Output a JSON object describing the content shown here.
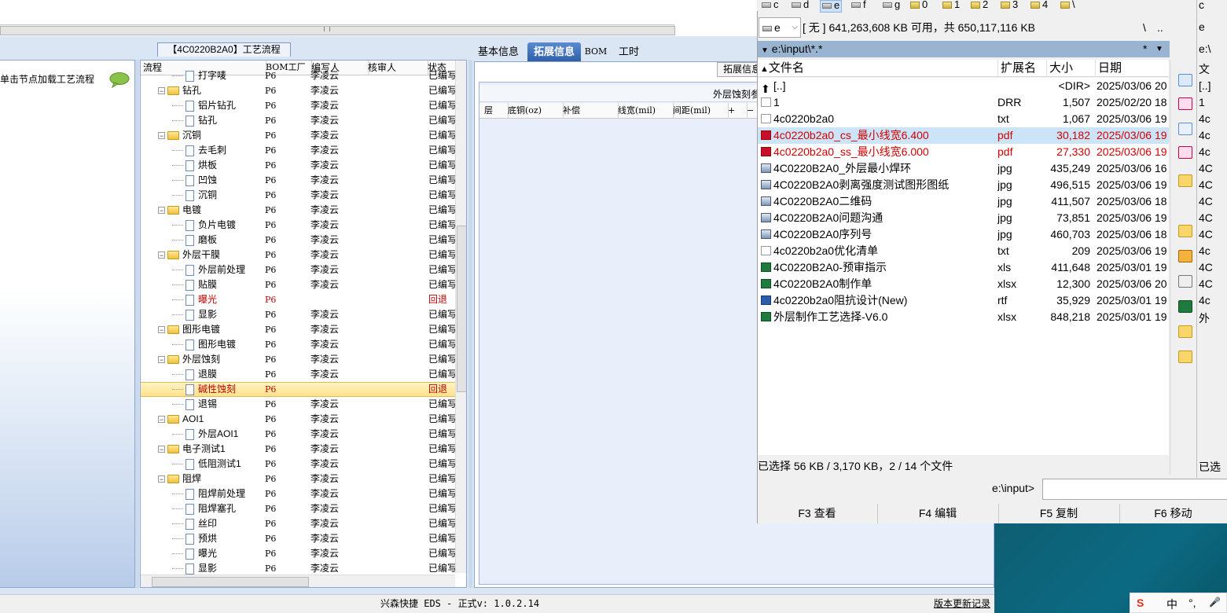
{
  "eds": {
    "left_panel": {
      "hint": "单击节点加载工艺流程"
    },
    "process_panel": {
      "title": "【4C0220B2A0】工艺流程",
      "columns": [
        "流程",
        "BOM工厂",
        "编写人",
        "核审人",
        "状态"
      ],
      "rows": [
        {
          "kind": "step",
          "name": "打字唛",
          "factory": "P6",
          "writer": "李凌云",
          "status": "已编写"
        },
        {
          "kind": "group",
          "name": "钻孔",
          "factory": "P6",
          "writer": "李凌云",
          "status": "已编写"
        },
        {
          "kind": "step",
          "name": "铝片钻孔",
          "factory": "P6",
          "writer": "李凌云",
          "status": "已编写"
        },
        {
          "kind": "step",
          "name": "钻孔",
          "factory": "P6",
          "writer": "李凌云",
          "status": "已编写"
        },
        {
          "kind": "group",
          "name": "沉铜",
          "factory": "P6",
          "writer": "李凌云",
          "status": "已编写"
        },
        {
          "kind": "step",
          "name": "去毛刺",
          "factory": "P6",
          "writer": "李凌云",
          "status": "已编写"
        },
        {
          "kind": "step",
          "name": "烘板",
          "factory": "P6",
          "writer": "李凌云",
          "status": "已编写"
        },
        {
          "kind": "step",
          "name": "凹蚀",
          "factory": "P6",
          "writer": "李凌云",
          "status": "已编写"
        },
        {
          "kind": "step",
          "name": "沉铜",
          "factory": "P6",
          "writer": "李凌云",
          "status": "已编写"
        },
        {
          "kind": "group",
          "name": "电镀",
          "factory": "P6",
          "writer": "李凌云",
          "status": "已编写"
        },
        {
          "kind": "step",
          "name": "负片电镀",
          "factory": "P6",
          "writer": "李凌云",
          "status": "已编写"
        },
        {
          "kind": "step",
          "name": "磨板",
          "factory": "P6",
          "writer": "李凌云",
          "status": "已编写"
        },
        {
          "kind": "group",
          "name": "外层干膜",
          "factory": "P6",
          "writer": "李凌云",
          "status": "已编写"
        },
        {
          "kind": "step",
          "name": "外层前处理",
          "factory": "P6",
          "writer": "李凌云",
          "status": "已编写"
        },
        {
          "kind": "step",
          "name": "贴膜",
          "factory": "P6",
          "writer": "李凌云",
          "status": "已编写"
        },
        {
          "kind": "step",
          "name": "曝光",
          "factory": "P6",
          "writer": "",
          "status": "回退",
          "red": true
        },
        {
          "kind": "step",
          "name": "显影",
          "factory": "P6",
          "writer": "李凌云",
          "status": "已编写"
        },
        {
          "kind": "group",
          "name": "图形电镀",
          "factory": "P6",
          "writer": "李凌云",
          "status": "已编写"
        },
        {
          "kind": "step",
          "name": "图形电镀",
          "factory": "P6",
          "writer": "李凌云",
          "status": "已编写"
        },
        {
          "kind": "group",
          "name": "外层蚀刻",
          "factory": "P6",
          "writer": "李凌云",
          "status": "已编写"
        },
        {
          "kind": "step",
          "name": "退膜",
          "factory": "P6",
          "writer": "李凌云",
          "status": "已编写"
        },
        {
          "kind": "step",
          "name": "碱性蚀刻",
          "factory": "P6",
          "writer": "",
          "status": "回退",
          "red": true,
          "selected": true
        },
        {
          "kind": "step",
          "name": "退锡",
          "factory": "P6",
          "writer": "李凌云",
          "status": "已编写"
        },
        {
          "kind": "group",
          "name": "AOI1",
          "factory": "P6",
          "writer": "李凌云",
          "status": "已编写"
        },
        {
          "kind": "step",
          "name": "外层AOI1",
          "factory": "P6",
          "writer": "李凌云",
          "status": "已编写"
        },
        {
          "kind": "group",
          "name": "电子测试1",
          "factory": "P6",
          "writer": "李凌云",
          "status": "已编写"
        },
        {
          "kind": "step",
          "name": "低阻测试1",
          "factory": "P6",
          "writer": "李凌云",
          "status": "已编写"
        },
        {
          "kind": "group",
          "name": "阻焊",
          "factory": "P6",
          "writer": "李凌云",
          "status": "已编写"
        },
        {
          "kind": "step",
          "name": "阻焊前处理",
          "factory": "P6",
          "writer": "李凌云",
          "status": "已编写"
        },
        {
          "kind": "step",
          "name": "阻焊塞孔",
          "factory": "P6",
          "writer": "李凌云",
          "status": "已编写"
        },
        {
          "kind": "step",
          "name": "丝印",
          "factory": "P6",
          "writer": "李凌云",
          "status": "已编写"
        },
        {
          "kind": "step",
          "name": "预烘",
          "factory": "P6",
          "writer": "李凌云",
          "status": "已编写"
        },
        {
          "kind": "step",
          "name": "曝光",
          "factory": "P6",
          "writer": "李凌云",
          "status": "已编写"
        },
        {
          "kind": "step",
          "name": "显影",
          "factory": "P6",
          "writer": "李凌云",
          "status": "已编写"
        }
      ]
    },
    "info_panel": {
      "tabs": [
        "基本信息",
        "拓展信息",
        "BOM",
        "工时"
      ],
      "active_tab": "拓展信息",
      "ext_info_button": "拓展信息",
      "grid_title": "外层蚀刻参",
      "grid_columns": [
        "层",
        "底铜(oz)",
        "补偿",
        "线宽(mil)",
        "间距(mil)",
        "+",
        "−"
      ]
    },
    "status_bar": {
      "text": "兴森快捷 EDS - 正式v: 1.0.2.14",
      "version_link": "版本更新记录"
    }
  },
  "total_commander": {
    "drives": [
      {
        "label": "c",
        "icon": "drive-icon"
      },
      {
        "label": "d",
        "icon": "drive-icon"
      },
      {
        "label": "e",
        "icon": "drive-icon",
        "active": true
      },
      {
        "label": "f",
        "icon": "drive-icon"
      },
      {
        "label": "g",
        "icon": "drive-icon"
      },
      {
        "label": "0",
        "icon": "folder-icon"
      },
      {
        "label": "1",
        "icon": "folder-icon"
      },
      {
        "label": "2",
        "icon": "folder-icon"
      },
      {
        "label": "3",
        "icon": "folder-icon"
      },
      {
        "label": "4",
        "icon": "folder-icon"
      },
      {
        "label": "\\",
        "icon": "network-icon"
      }
    ],
    "drive_select": "e",
    "disk_info": "[ 无 ]  641,263,608 KB 可用，共 650,117,116 KB",
    "nav": {
      "root": "\\",
      "up": ".."
    },
    "path": "e:\\input\\*.*",
    "path_tools": {
      "star": "*",
      "arrow": "▼"
    },
    "columns": {
      "name": "文件名",
      "ext": "扩展名",
      "size": "大小",
      "date": "日期"
    },
    "files": [
      {
        "name": "[..]",
        "ext": "",
        "size": "<DIR>",
        "date": "2025/03/06 20",
        "icon": "up"
      },
      {
        "name": "1",
        "ext": "DRR",
        "size": "1,507",
        "date": "2025/02/20 18",
        "icon": "doc"
      },
      {
        "name": "4c0220b2a0",
        "ext": "txt",
        "size": "1,067",
        "date": "2025/03/06 19",
        "icon": "doc"
      },
      {
        "name": "4c0220b2a0_cs_最小线宽6.400",
        "ext": "pdf",
        "size": "30,182",
        "date": "2025/03/06 19",
        "icon": "pdf",
        "red": true,
        "cursor": true
      },
      {
        "name": "4c0220b2a0_ss_最小线宽6.000",
        "ext": "pdf",
        "size": "27,330",
        "date": "2025/03/06 19",
        "icon": "pdf",
        "red": true
      },
      {
        "name": "4C0220B2A0_外层最小焊环",
        "ext": "jpg",
        "size": "435,249",
        "date": "2025/03/06 16",
        "icon": "img"
      },
      {
        "name": "4C0220B2A0剥离强度测试图形图纸",
        "ext": "jpg",
        "size": "496,515",
        "date": "2025/03/06 19",
        "icon": "img"
      },
      {
        "name": "4C0220B2A0二维码",
        "ext": "jpg",
        "size": "411,507",
        "date": "2025/03/06 18",
        "icon": "img"
      },
      {
        "name": "4C0220B2A0问题沟通",
        "ext": "jpg",
        "size": "73,851",
        "date": "2025/03/06 19",
        "icon": "img"
      },
      {
        "name": "4C0220B2A0序列号",
        "ext": "jpg",
        "size": "460,703",
        "date": "2025/03/06 18",
        "icon": "img"
      },
      {
        "name": "4c0220b2a0优化清单",
        "ext": "txt",
        "size": "209",
        "date": "2025/03/06 19",
        "icon": "doc"
      },
      {
        "name": "4C0220B2A0-预审指示",
        "ext": "xls",
        "size": "411,648",
        "date": "2025/03/01 19",
        "icon": "xls"
      },
      {
        "name": "4C0220B2A0制作单",
        "ext": "xlsx",
        "size": "12,300",
        "date": "2025/03/06 20",
        "icon": "xls"
      },
      {
        "name": "4c0220b2a0阻抗设计(New)",
        "ext": "rtf",
        "size": "35,929",
        "date": "2025/03/01 19",
        "icon": "rtf"
      },
      {
        "name": "外层制作工艺选择-V6.0",
        "ext": "xlsx",
        "size": "848,218",
        "date": "2025/03/01 19",
        "icon": "xls"
      }
    ],
    "selection_status": "已选择 56 KB / 3,170 KB，2 / 14 个文件",
    "cmd_label": "e:\\input>",
    "fkeys": [
      "F3 查看",
      "F4 编辑",
      "F5 复制",
      "F6 移动"
    ],
    "right_panel": {
      "drive_letters": [
        "c",
        "e"
      ],
      "path": "e:\\",
      "head": "文",
      "items": [
        "[..]",
        "1",
        "4c",
        "4c",
        "4c",
        "4C",
        "4C",
        "4C",
        "4C",
        "4C",
        "4c",
        "4C",
        "4C",
        "4c",
        "外"
      ],
      "status": "已选"
    }
  },
  "taskbar": {
    "ime": [
      "S",
      "中",
      "°,",
      "🎤"
    ]
  },
  "colors": {
    "accent": "#2f5fa8",
    "tc_path": "#99b4d1",
    "red": "#d40000"
  }
}
